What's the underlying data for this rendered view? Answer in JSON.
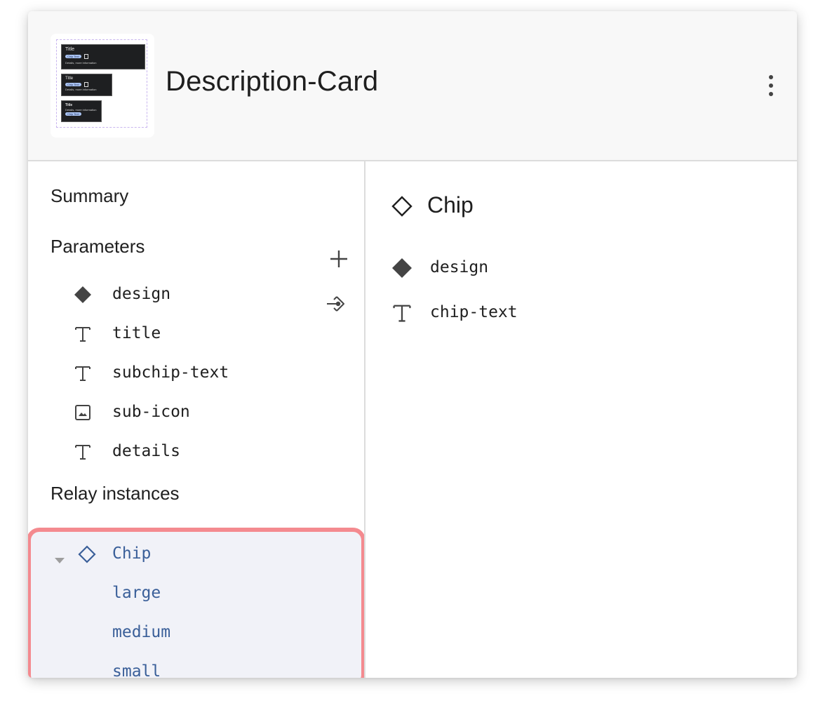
{
  "header": {
    "title": "Description-Card",
    "more_icon": "more-vert-icon",
    "thumbnail": {
      "variants": [
        {
          "title": "Title",
          "chip": "Chip Text",
          "details": "Details, more information"
        },
        {
          "title": "Title",
          "chip": "Chip Text",
          "details": "Details, more information"
        },
        {
          "title": "Title",
          "chip": "Chip Text",
          "details": "Details, more information"
        }
      ]
    }
  },
  "left": {
    "summary_label": "Summary",
    "parameters_label": "Parameters",
    "add_icon": "plus-icon",
    "parameters": [
      {
        "name": "design",
        "icon": "diamond-filled-icon"
      },
      {
        "name": "title",
        "icon": "text-icon"
      },
      {
        "name": "subchip-text",
        "icon": "text-icon"
      },
      {
        "name": "sub-icon",
        "icon": "image-icon"
      },
      {
        "name": "details",
        "icon": "text-icon"
      }
    ],
    "relay_label": "Relay instances",
    "relay": {
      "name": "Chip",
      "icon": "diamond-outline-icon",
      "expanded": true,
      "variants": [
        "large",
        "medium",
        "small"
      ]
    }
  },
  "right": {
    "title": "Chip",
    "title_icon": "diamond-outline-icon",
    "params": [
      {
        "name": "design",
        "icon": "diamond-filled-icon"
      },
      {
        "name": "chip-text",
        "icon": "text-icon"
      }
    ]
  },
  "colors": {
    "highlight_border": "#f48a8f",
    "highlight_bg": "#f1f2f8",
    "relay_text": "#3a5f99",
    "header_bg": "#f8f8f8"
  }
}
